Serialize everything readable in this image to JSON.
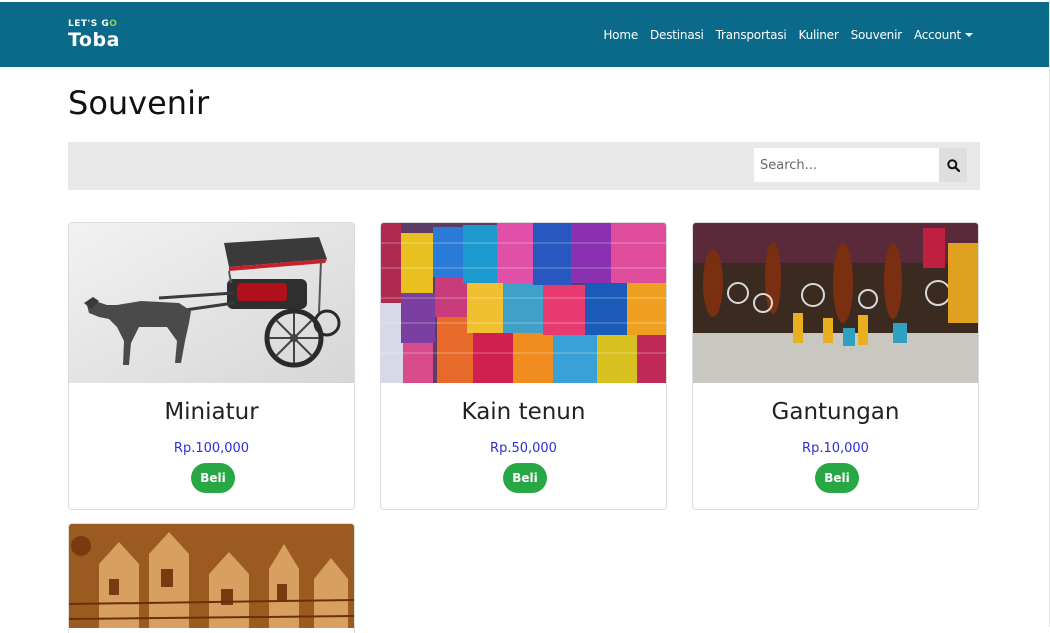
{
  "brand": {
    "small_text_1": "LET'S G",
    "small_text_go": "O",
    "big_text": "Toba"
  },
  "nav": {
    "home": "Home",
    "destinasi": "Destinasi",
    "transportasi": "Transportasi",
    "kuliner": "Kuliner",
    "souvenir": "Souvenir",
    "account": "Account"
  },
  "page": {
    "title": "Souvenir"
  },
  "search": {
    "placeholder": "Search...",
    "value": "",
    "icon": "search-icon"
  },
  "products": [
    {
      "name": "Miniatur",
      "price": "Rp.100,000",
      "button_label": "Beli",
      "image": "horse-carriage-miniature"
    },
    {
      "name": "Kain tenun",
      "price": "Rp.50,000",
      "button_label": "Beli",
      "image": "woven-cloth"
    },
    {
      "name": "Gantungan",
      "price": "Rp.10,000",
      "button_label": "Beli",
      "image": "hanging-ornaments"
    },
    {
      "image": "wood-carving"
    }
  ],
  "colors": {
    "navbar": "#0b6a89",
    "price": "#2b2fd6",
    "buy_button": "#28a745",
    "search_bar_bg": "#e9e9e9"
  }
}
